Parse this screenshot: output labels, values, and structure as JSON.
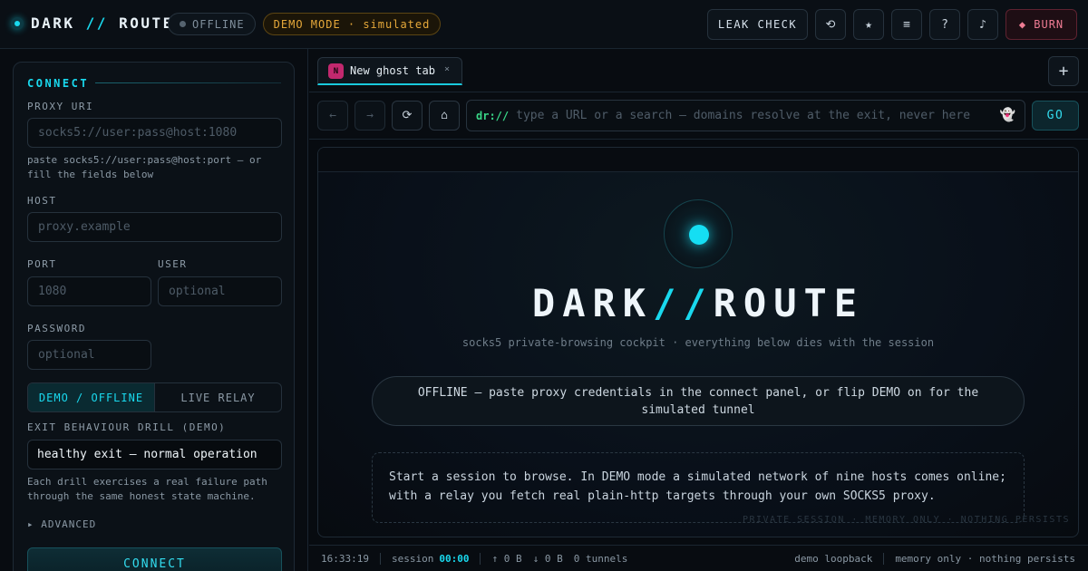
{
  "header": {
    "brand_left": "DARK",
    "brand_slash": "//",
    "brand_right": "ROUTE",
    "status_pill": "OFFLINE",
    "demo_pill": "DEMO MODE · simulated",
    "leak_check": "LEAK CHECK",
    "icons": {
      "history": "⟲",
      "bookmark": "★",
      "menu": "≡",
      "help": "?",
      "sound": "♪"
    },
    "burn": "◆ BURN"
  },
  "connect": {
    "title": "CONNECT",
    "proxy_uri_label": "PROXY URI",
    "proxy_uri_placeholder": "socks5://user:pass@host:1080",
    "proxy_hint": "paste socks5://user:pass@host:port — or fill the fields below",
    "host_label": "HOST",
    "host_placeholder": "proxy.example",
    "port_label": "PORT",
    "port_placeholder": "1080",
    "user_label": "USER",
    "user_placeholder": "optional",
    "password_label": "PASSWORD",
    "password_placeholder": "optional",
    "mode_demo": "DEMO / OFFLINE",
    "mode_live": "LIVE RELAY",
    "drill_label": "EXIT BEHAVIOUR DRILL (DEMO)",
    "drill_value": "healthy exit — normal operation",
    "drill_hint": "Each drill exercises a real failure path through the same honest state machine.",
    "advanced": "▸ ADVANCED",
    "connect_button": "CONNECT"
  },
  "tabs": {
    "items": [
      {
        "favicon": "N",
        "title": "New ghost tab",
        "close": "×"
      }
    ],
    "new_tab": "+"
  },
  "nav": {
    "back": "←",
    "forward": "→",
    "reload": "⟳",
    "home": "⌂",
    "scheme": "dr://",
    "url_placeholder": "type a URL or a search — domains resolve at the exit, never here",
    "ghost": "👻",
    "go": "GO"
  },
  "page": {
    "title_left": "DARK",
    "title_slash": "//",
    "title_right": "ROUTE",
    "subtitle": "socks5 private-browsing cockpit · everything below dies with the session",
    "status_message": "OFFLINE — paste proxy credentials in the connect panel, or flip DEMO on for the simulated tunnel",
    "info": "Start a session to browse. In DEMO mode a simulated network of nine hosts comes online; with a relay you fetch real plain-http targets through your own SOCKS5 proxy.",
    "watermark": "PRIVATE SESSION · MEMORY ONLY · NOTHING PERSISTS"
  },
  "statusbar": {
    "clock": "16:33:19",
    "session_label": "session",
    "session_time": "00:00",
    "up": "↑ 0 B",
    "down": "↓ 0 B",
    "tunnels": "0 tunnels",
    "mode": "demo loopback",
    "memory": "memory only · nothing persists"
  },
  "colors": {
    "accent": "#19d9ee",
    "warning": "#e5a83a",
    "danger": "#ef7c94",
    "background": "#070b10"
  }
}
